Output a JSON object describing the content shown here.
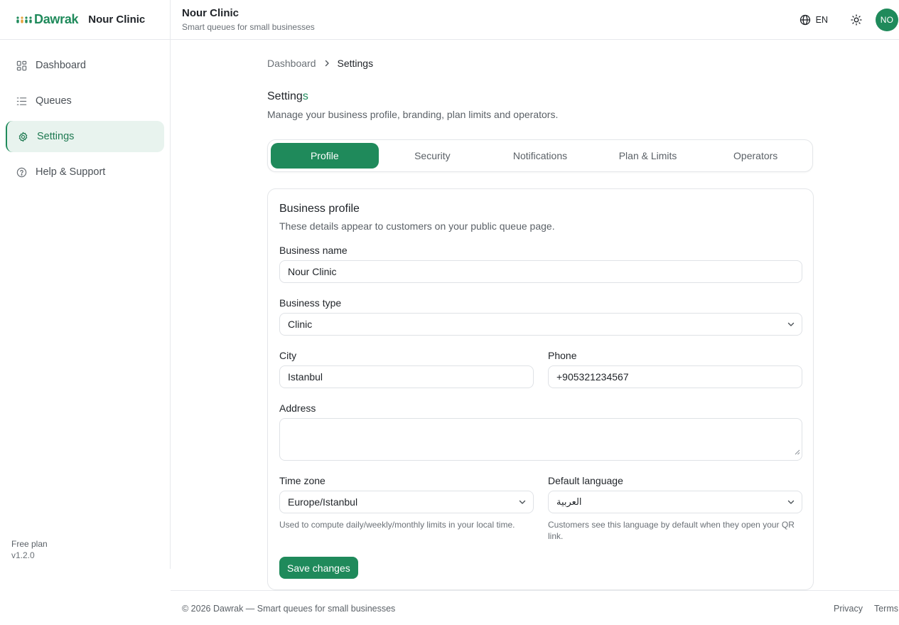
{
  "brand": {
    "logo_text": "Dawrak",
    "business_name": "Nour Clinic"
  },
  "header": {
    "title": "Nour Clinic",
    "subtitle": "Smart queues for small businesses",
    "language": "EN",
    "avatar_initials": "NO",
    "icons": {
      "language": "globe-icon",
      "theme": "sun-icon"
    }
  },
  "sidebar": {
    "items": [
      {
        "label": "Dashboard",
        "icon": "grid-icon",
        "active": false
      },
      {
        "label": "Queues",
        "icon": "list-icon",
        "active": false
      },
      {
        "label": "Settings",
        "icon": "gear-icon",
        "active": true
      },
      {
        "label": "Help & Support",
        "icon": "help-circle-icon",
        "active": false
      }
    ],
    "plan": "Free plan",
    "version": "v1.2.0"
  },
  "breadcrumb": {
    "parent": "Dashboard",
    "current": "Settings"
  },
  "page": {
    "title_main": "Setting",
    "title_accent": "s",
    "description": "Manage your business profile, branding, plan limits and operators."
  },
  "tabs": [
    {
      "label": "Profile",
      "active": true
    },
    {
      "label": "Security",
      "active": false
    },
    {
      "label": "Notifications",
      "active": false
    },
    {
      "label": "Plan & Limits",
      "active": false
    },
    {
      "label": "Operators",
      "active": false
    }
  ],
  "profile": {
    "title": "Business profile",
    "description": "These details appear to customers on your public queue page.",
    "business_name": {
      "label": "Business name",
      "value": "Nour Clinic"
    },
    "business_type": {
      "label": "Business type",
      "value": "Clinic"
    },
    "city": {
      "label": "City",
      "value": "Istanbul"
    },
    "phone": {
      "label": "Phone",
      "value": "+905321234567"
    },
    "address": {
      "label": "Address",
      "value": ""
    },
    "time_zone": {
      "label": "Time zone",
      "value": "Europe/Istanbul",
      "help": "Used to compute daily/weekly/monthly limits in your local time."
    },
    "default_language": {
      "label": "Default language",
      "value": "العربية",
      "help": "Customers see this language by default when they open your QR link."
    },
    "save_label": "Save changes"
  },
  "footer": {
    "copyright": "© 2026 Dawrak — Smart queues for small businesses",
    "links": [
      "Privacy",
      "Terms"
    ]
  },
  "colors": {
    "accent": "#1f8a5b",
    "accent_bg": "#e8f3ee",
    "border": "#e4e6e9",
    "muted_text": "#6b7177"
  }
}
